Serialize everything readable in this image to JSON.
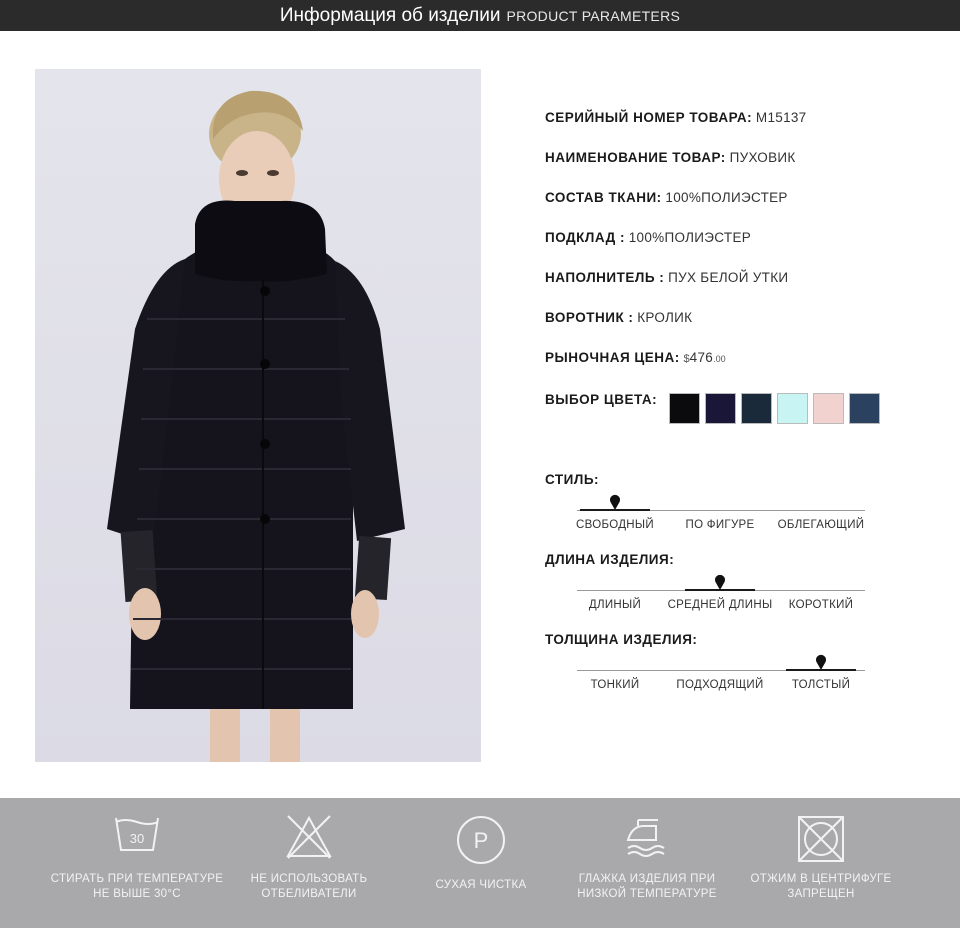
{
  "header": {
    "title": "Информация об изделии",
    "subtitle": "PRODUCT PARAMETERS"
  },
  "product": {
    "serial": {
      "label": "СЕРИЙНЫЙ НОМЕР ТОВАРА:",
      "value": "M15137"
    },
    "name": {
      "label": "НАИМЕНОВАНИЕ ТОВАР:",
      "value": "ПУХОВИК"
    },
    "fabric": {
      "label": "СОСТАВ ТКАНИ:",
      "value": "100%ПОЛИЭСТЕР"
    },
    "lining": {
      "label": "ПОДКЛАД :",
      "value": "100%ПОЛИЭСТЕР"
    },
    "filler": {
      "label": "НАПОЛНИТЕЛЬ :",
      "value": "ПУХ БЕЛОЙ УТКИ"
    },
    "collar": {
      "label": "ВОРОТНИК :",
      "value": "КРОЛИК"
    },
    "price": {
      "label": "РЫНОЧНАЯ ЦЕНА:",
      "currency": "$",
      "amount": "476",
      "cents": ".00"
    },
    "colors": {
      "label": "ВЫБОР ЦВЕТА:",
      "swatches": [
        "#0b0b0d",
        "#1a1638",
        "#1b2a3a",
        "#c9f4f4",
        "#f1d2cf",
        "#2a4160"
      ]
    }
  },
  "scales": {
    "style": {
      "label": "СТИЛЬ:",
      "options": [
        "СВОБОДНЫЙ",
        "ПО ФИГУРЕ",
        "ОБЛЕГАЮЩИЙ"
      ],
      "selected": "СВОБОДНЫЙ"
    },
    "length": {
      "label": "ДЛИНА ИЗДЕЛИЯ:",
      "options": [
        "ДЛИНЫЙ",
        "СРЕДНЕЙ ДЛИНЫ",
        "КОРОТКИЙ"
      ],
      "selected": "СРЕДНЕЙ ДЛИНЫ"
    },
    "thickness": {
      "label": "ТОЛЩИНА ИЗДЕЛИЯ:",
      "options": [
        "ТОНКИЙ",
        "ПОДХОДЯЩИЙ",
        "ТОЛСТЫЙ"
      ],
      "selected": "ТОЛСТЫЙ"
    }
  },
  "care": [
    {
      "icon": "wash-30-icon",
      "temp": "30",
      "line1": "СТИРАТЬ ПРИ ТЕМПЕРАТУРЕ",
      "line2": "НЕ ВЫШЕ 30°C"
    },
    {
      "icon": "no-bleach-icon",
      "line1": "НЕ ИСПОЛЬЗОВАТЬ",
      "line2": "ОТБЕЛИВАТЕЛИ"
    },
    {
      "icon": "dry-clean-icon",
      "letter": "P",
      "line1": "СУХАЯ ЧИСТКА",
      "line2": ""
    },
    {
      "icon": "iron-low-icon",
      "line1": "ГЛАЖКА ИЗДЕЛИЯ ПРИ",
      "line2": "НИЗКОЙ ТЕМПЕРАТУРЕ"
    },
    {
      "icon": "no-tumble-dry-icon",
      "line1": "ОТЖИМ В ЦЕНТРИФУГЕ",
      "line2": "ЗАПРЕЩЕН"
    }
  ]
}
